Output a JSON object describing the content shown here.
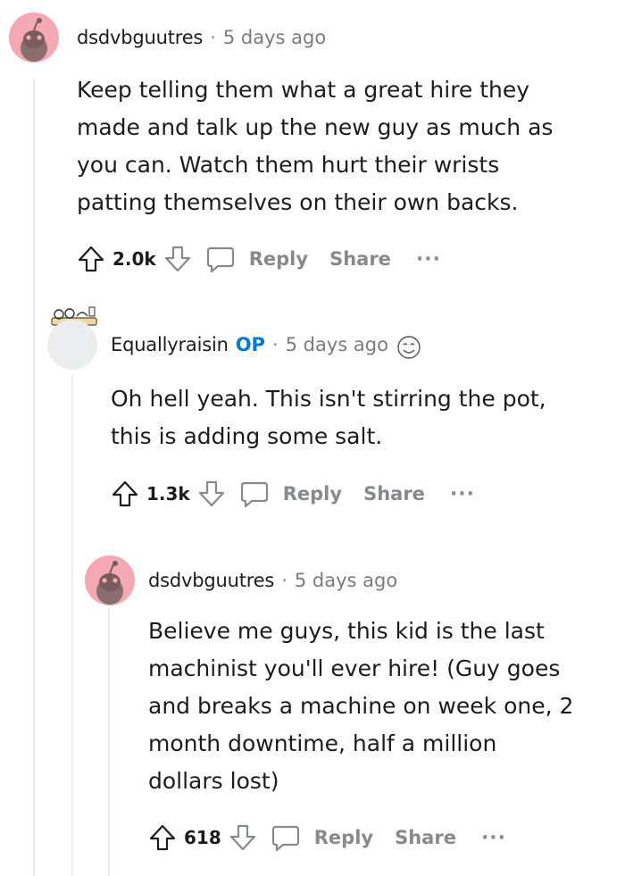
{
  "comments": [
    {
      "username": "dsdvbguutres",
      "time": "5 days ago",
      "lines": [
        "Keep telling them what a great hire they",
        "made and talk up the new guy as much as",
        "you can. Watch them hurt their wrists",
        "patting themselves on their own backs."
      ],
      "votes": "2.0k",
      "reply_label": "Reply",
      "share_label": "Share",
      "more_label": "···"
    },
    {
      "username": "Equallyraisin",
      "badge": "OP",
      "time": "5 days ago",
      "lines": [
        "Oh hell yeah. This isn't stirring the pot,",
        "this is adding some salt."
      ],
      "votes": "1.3k",
      "reply_label": "Reply",
      "share_label": "Share",
      "more_label": "···"
    },
    {
      "username": "dsdvbguutres",
      "time": "5 days ago",
      "lines": [
        "Believe me guys, this kid is the last",
        "machinist you'll ever hire! (Guy goes",
        "and breaks a machine on week one, 2",
        "month downtime, half a million",
        "dollars lost)"
      ],
      "votes": "618",
      "reply_label": "Reply",
      "share_label": "Share",
      "more_label": "···"
    }
  ],
  "colors": {
    "avatar_pink": "#f4a8b2",
    "op_blue": "#0079d3",
    "muted_gray": "#878a8c",
    "thread_line": "#edeff1"
  },
  "icons": [
    "snoo-avatar-icon",
    "upvote-icon",
    "downvote-icon",
    "comment-icon",
    "emoji-icon"
  ]
}
